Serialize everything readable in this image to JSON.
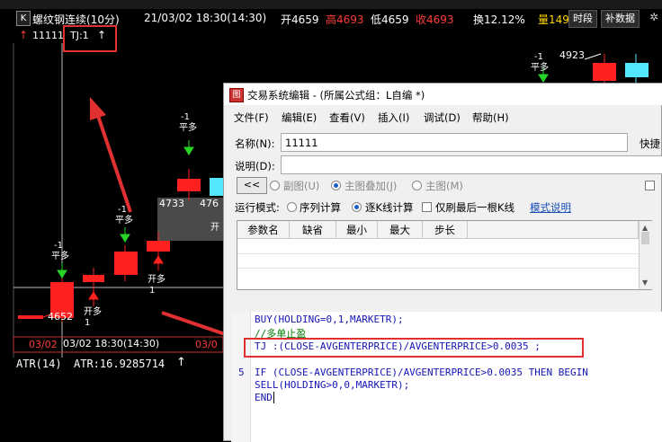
{
  "header": {
    "k_badge": "K",
    "instrument": "螺纹钢连续(10分)",
    "datetime": "21/03/02 18:30(14:30)",
    "open_label": "开4659",
    "high_label": "高4693",
    "low_label": "低4659",
    "close_label": "收4693",
    "turnover_label": "换12.12%",
    "amount_label": "量149",
    "time_segment_button": "时段",
    "fill_data_button": "补数据"
  },
  "indicator_line": {
    "arrow": "↑",
    "name": "11111",
    "tj_label": "TJ:1",
    "tj_arrow": "↑"
  },
  "chart": {
    "annotations": [
      {
        "text": "-1"
      },
      {
        "text": "平多"
      },
      {
        "text": "-1"
      },
      {
        "text": "平多"
      },
      {
        "text": "-1"
      },
      {
        "text": "平多"
      },
      {
        "text": "-1"
      },
      {
        "text": "平多"
      },
      {
        "text": "开多"
      },
      {
        "text": "1"
      },
      {
        "text": "开多"
      },
      {
        "text": "1"
      },
      {
        "text": "开多"
      },
      {
        "text": "1"
      }
    ],
    "price_4923": "4923",
    "price_4733": "4733",
    "price_476": "476",
    "price_4652": "4652",
    "axis_date_1": "03/02",
    "axis_datetime": "03/02 18:30(14:30)",
    "axis_date_2": "03/0",
    "cut_label": "开",
    "atr_label": "ATR(14)",
    "atr_value": "ATR:16.9285714",
    "atr_arrow": "↑"
  },
  "colors": {
    "up_candle": "#ff2020",
    "down_candle": "#52e6ff",
    "signal_arrow": "#27d327",
    "price_band": "#4a4a4a",
    "annotation_box": "#e03030"
  },
  "dialog": {
    "title": "交易系统编辑 - (所属公式组：L自编 *)",
    "menu": [
      "文件(F)",
      "编辑(E)",
      "查看(V)",
      "插入(I)",
      "调试(D)",
      "帮助(H)"
    ],
    "name_label": "名称(N):",
    "name_value": "11111",
    "shortcut_label": "快捷",
    "desc_label": "说明(D):",
    "desc_value": "",
    "back_button": "<<",
    "draw_options": [
      {
        "label": "副图(U)",
        "selected": false
      },
      {
        "label": "主图叠加(J)",
        "selected": true
      },
      {
        "label": "主图(M)",
        "selected": false
      }
    ],
    "run_mode_label": "运行模式:",
    "run_modes": [
      {
        "label": "序列计算",
        "selected": false
      },
      {
        "label": "逐K线计算",
        "selected": true
      }
    ],
    "last_bar_only_label": "仅刷最后一根K线",
    "mode_help_link": "模式说明",
    "param_headers": [
      "参数名",
      "缺省",
      "最小",
      "最大",
      "步长"
    ],
    "code": {
      "line1": "BUY(HOLDING=0,1,MARKETR);",
      "line2": "//多单止盈",
      "line3": "TJ :(CLOSE-AVGENTERPRICE)/AVGENTERPRICE>0.0035 ;",
      "line4": "",
      "line5": "IF (CLOSE-AVGENTERPRICE)/AVGENTERPRICE>0.0035 THEN BEGIN",
      "line6": "SELL(HOLDING>0,0,MARKETR);",
      "line7": "END",
      "line_number_5": "5"
    }
  }
}
